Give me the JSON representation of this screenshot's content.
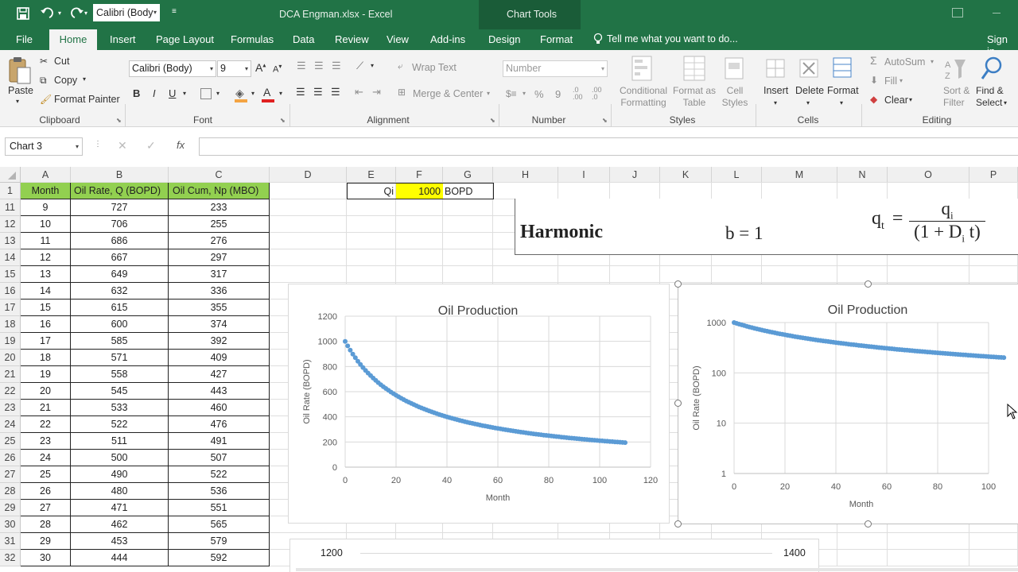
{
  "qat": {
    "font_value": "Calibri (Body"
  },
  "window": {
    "title": "DCA Engman.xlsx - Excel",
    "context_title": "Chart Tools"
  },
  "tabs": {
    "file": "File",
    "home": "Home",
    "insert": "Insert",
    "page_layout": "Page Layout",
    "formulas": "Formulas",
    "data": "Data",
    "review": "Review",
    "view": "View",
    "addins": "Add-ins",
    "design": "Design",
    "format": "Format",
    "tell_me": "Tell me what you want to do...",
    "signin": "Sign in"
  },
  "ribbon": {
    "clipboard": {
      "paste": "Paste",
      "cut": "Cut",
      "copy": "Copy",
      "format_painter": "Format Painter",
      "label": "Clipboard"
    },
    "font": {
      "family": "Calibri (Body)",
      "size": "9",
      "bold": "B",
      "italic": "I",
      "underline": "U",
      "label": "Font"
    },
    "alignment": {
      "wrap_text": "Wrap Text",
      "merge_center": "Merge & Center",
      "label": "Alignment"
    },
    "number": {
      "format": "Number",
      "percent": "%",
      "comma": "9",
      "label": "Number"
    },
    "styles": {
      "conditional_1": "Conditional",
      "conditional_2": "Formatting",
      "format_table_1": "Format as",
      "format_table_2": "Table",
      "cell_styles_1": "Cell",
      "cell_styles_2": "Styles",
      "label": "Styles"
    },
    "cells": {
      "insert": "Insert",
      "delete": "Delete",
      "format": "Format",
      "label": "Cells"
    },
    "editing": {
      "autosum": "AutoSum",
      "fill": "Fill",
      "clear": "Clear",
      "sort_filter_1": "Sort &",
      "sort_filter_2": "Filter",
      "find_select_1": "Find &",
      "find_select_2": "Select",
      "label": "Editing"
    }
  },
  "formula_bar": {
    "name_box": "Chart 3",
    "fx": "fx",
    "formula": ""
  },
  "columns": [
    "A",
    "B",
    "C",
    "D",
    "E",
    "F",
    "G",
    "H",
    "I",
    "J",
    "K",
    "L",
    "M",
    "N",
    "O",
    "P"
  ],
  "headers": {
    "a": "Month",
    "b": "Oil Rate, Q (BOPD)",
    "c": "Oil Cum, Np (MBO)"
  },
  "qi": {
    "label": "Qi",
    "value": "1000",
    "unit": "BOPD"
  },
  "rows": [
    {
      "num": "1"
    },
    {
      "num": "11",
      "month": "9",
      "rate": "727",
      "cum": "233"
    },
    {
      "num": "12",
      "month": "10",
      "rate": "706",
      "cum": "255"
    },
    {
      "num": "13",
      "month": "11",
      "rate": "686",
      "cum": "276"
    },
    {
      "num": "14",
      "month": "12",
      "rate": "667",
      "cum": "297"
    },
    {
      "num": "15",
      "month": "13",
      "rate": "649",
      "cum": "317"
    },
    {
      "num": "16",
      "month": "14",
      "rate": "632",
      "cum": "336"
    },
    {
      "num": "17",
      "month": "15",
      "rate": "615",
      "cum": "355"
    },
    {
      "num": "18",
      "month": "16",
      "rate": "600",
      "cum": "374"
    },
    {
      "num": "19",
      "month": "17",
      "rate": "585",
      "cum": "392"
    },
    {
      "num": "20",
      "month": "18",
      "rate": "571",
      "cum": "409"
    },
    {
      "num": "21",
      "month": "19",
      "rate": "558",
      "cum": "427"
    },
    {
      "num": "22",
      "month": "20",
      "rate": "545",
      "cum": "443"
    },
    {
      "num": "23",
      "month": "21",
      "rate": "533",
      "cum": "460"
    },
    {
      "num": "24",
      "month": "22",
      "rate": "522",
      "cum": "476"
    },
    {
      "num": "25",
      "month": "23",
      "rate": "511",
      "cum": "491"
    },
    {
      "num": "26",
      "month": "24",
      "rate": "500",
      "cum": "507"
    },
    {
      "num": "27",
      "month": "25",
      "rate": "490",
      "cum": "522"
    },
    {
      "num": "28",
      "month": "26",
      "rate": "480",
      "cum": "536"
    },
    {
      "num": "29",
      "month": "27",
      "rate": "471",
      "cum": "551"
    },
    {
      "num": "30",
      "month": "28",
      "rate": "462",
      "cum": "565"
    },
    {
      "num": "31",
      "month": "29",
      "rate": "453",
      "cum": "579"
    },
    {
      "num": "32",
      "month": "30",
      "rate": "444",
      "cum": "592"
    }
  ],
  "equation": {
    "title": "Harmonic",
    "b_eq": "b = 1",
    "lhs": "q",
    "lhs_sub": "t",
    "eq": "=",
    "num": "q",
    "num_sub": "i",
    "den_a": "(1 + D",
    "den_sub": "i",
    "den_b": " t)"
  },
  "bottom_chart": {
    "left_tick": "1200",
    "right_tick": "1400"
  },
  "colors": {
    "excel_green": "#217346",
    "header_fill": "#92d050",
    "qi_fill": "#ffff00",
    "series": "#5b9bd5"
  },
  "chart_data": [
    {
      "type": "scatter",
      "title": "Oil Production",
      "xlabel": "Month",
      "ylabel": "Oil Rate (BOPD)",
      "xlim": [
        0,
        120
      ],
      "ylim": [
        0,
        1200
      ],
      "xticks": [
        "0",
        "20",
        "40",
        "60",
        "80",
        "100",
        "120"
      ],
      "yticks": [
        "0",
        "200",
        "400",
        "600",
        "800",
        "1000",
        "1200"
      ],
      "yscale": "linear",
      "grid": true,
      "model": "harmonic",
      "qi": 1000,
      "month_range": [
        0,
        110
      ],
      "series": [
        {
          "x": [
            0,
            9,
            10,
            20,
            30,
            40,
            60,
            80,
            100,
            110
          ],
          "y": [
            1000,
            727,
            706,
            545,
            444,
            375,
            286,
            231,
            194,
            178
          ]
        }
      ]
    },
    {
      "type": "scatter",
      "title": "Oil Production",
      "xlabel": "Month",
      "ylabel": "Oil Rate (BOPD)",
      "xlim": [
        0,
        100
      ],
      "ylim": [
        1,
        1000
      ],
      "xticks": [
        "0",
        "20",
        "40",
        "60",
        "80",
        "100"
      ],
      "yticks": [
        "1",
        "10",
        "100",
        "1000"
      ],
      "yscale": "log",
      "grid": true,
      "model": "harmonic",
      "qi": 1000,
      "month_range": [
        0,
        110
      ],
      "series": [
        {
          "x": [
            0,
            20,
            40,
            60,
            80,
            100,
            110
          ],
          "y": [
            1000,
            545,
            375,
            286,
            231,
            194,
            178
          ]
        }
      ]
    }
  ]
}
